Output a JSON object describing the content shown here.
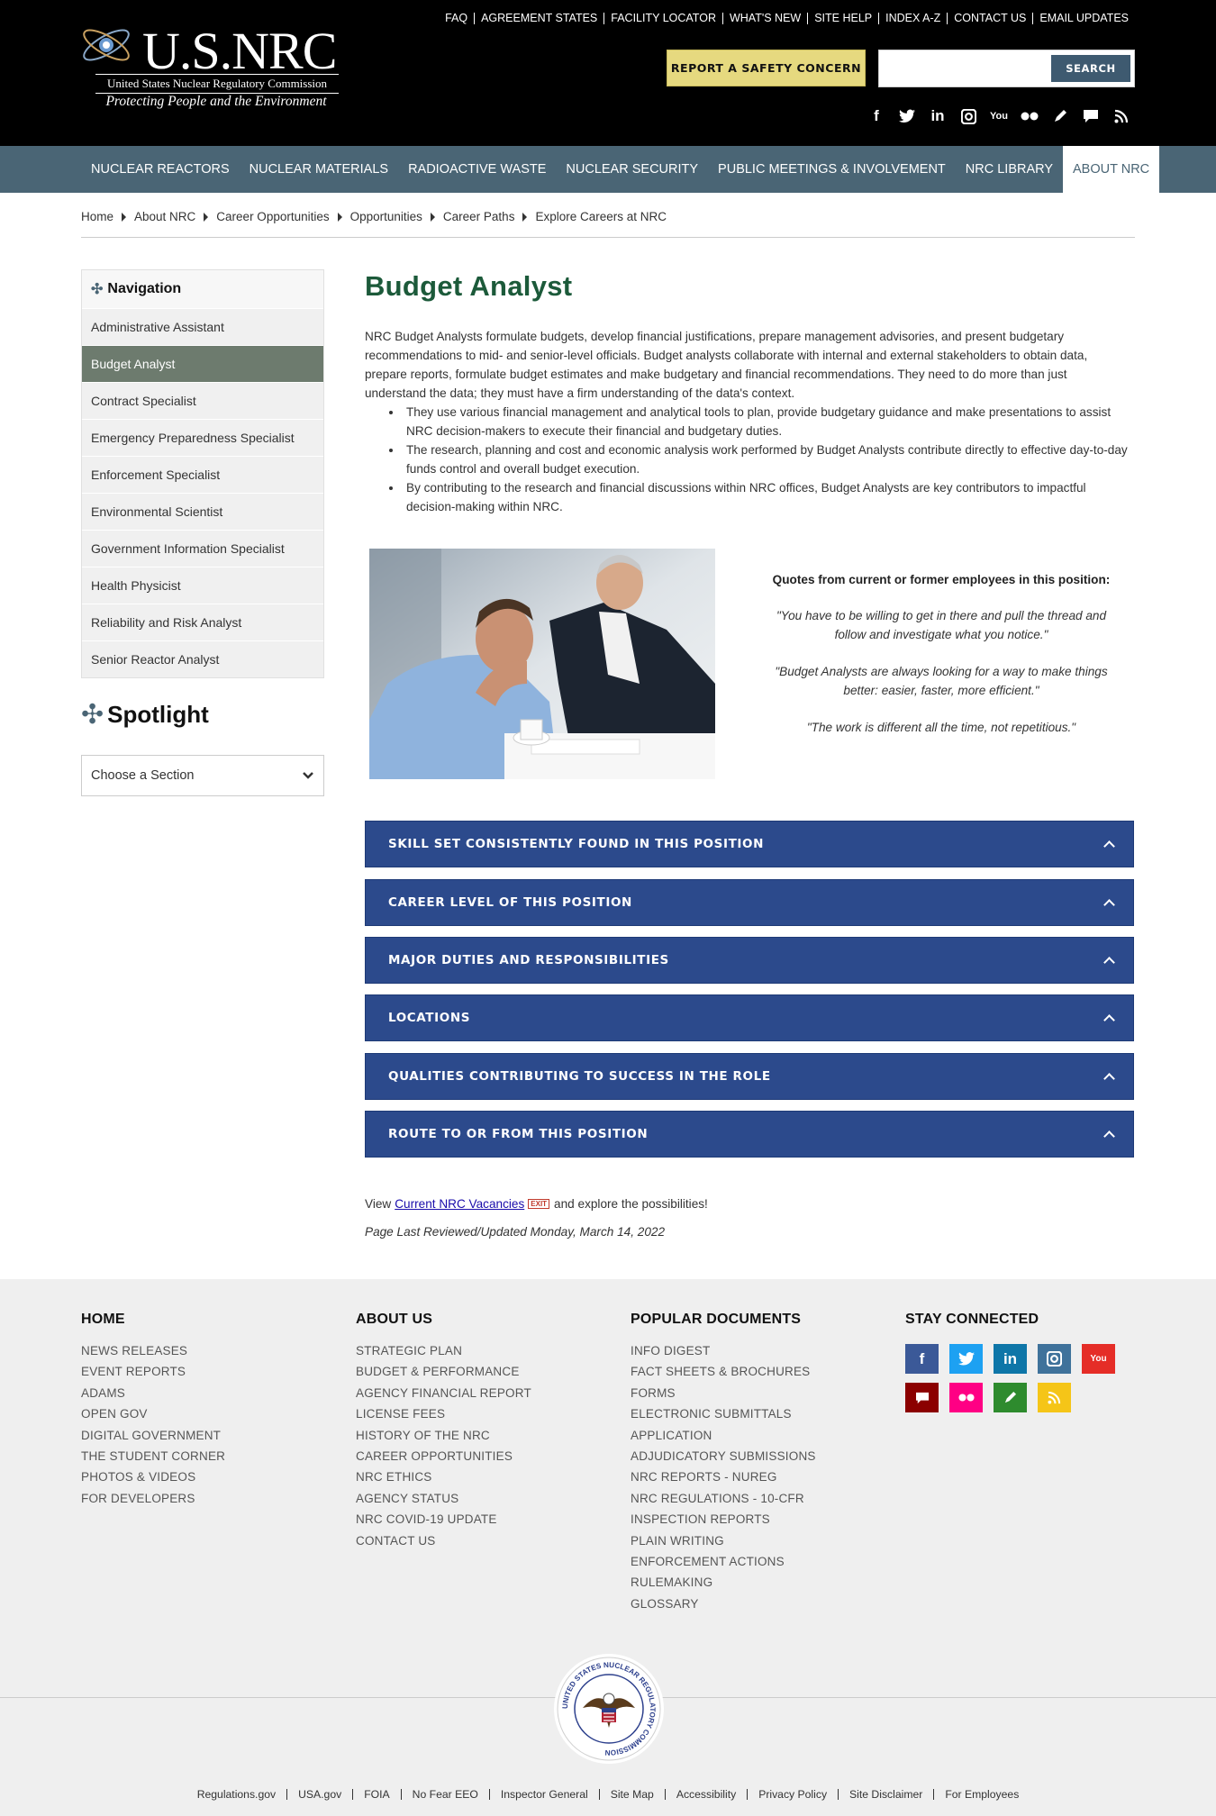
{
  "header": {
    "logo_name": "U.S.NRC",
    "logo_subtitle": "United States Nuclear Regulatory Commission",
    "logo_tagline": "Protecting People and the Environment",
    "utility_links": [
      "FAQ",
      "AGREEMENT STATES",
      "FACILITY LOCATOR",
      "WHAT'S NEW",
      "SITE HELP",
      "INDEX A-Z",
      "CONTACT US",
      "EMAIL UPDATES"
    ],
    "report_button": "REPORT A SAFETY CONCERN",
    "search_placeholder": "",
    "search_button": "SEARCH",
    "social_icons": [
      "facebook-icon",
      "twitter-icon",
      "linkedin-icon",
      "instagram-icon",
      "youtube-icon",
      "flickr-icon",
      "blog-icon",
      "chat-icon",
      "rss-icon"
    ]
  },
  "nav": {
    "items": [
      "NUCLEAR REACTORS",
      "NUCLEAR MATERIALS",
      "RADIOACTIVE WASTE",
      "NUCLEAR SECURITY",
      "PUBLIC MEETINGS & INVOLVEMENT",
      "NRC LIBRARY",
      "ABOUT NRC"
    ],
    "active": "ABOUT NRC"
  },
  "breadcrumb": [
    "Home",
    "About NRC",
    "Career Opportunities",
    "Opportunities",
    "Career Paths",
    "Explore Careers at NRC"
  ],
  "sidebar": {
    "heading": "Navigation",
    "items": [
      "Administrative Assistant",
      "Budget Analyst",
      "Contract Specialist",
      "Emergency Preparedness Specialist",
      "Enforcement Specialist",
      "Environmental Scientist",
      "Government Information Specialist",
      "Health Physicist",
      "Reliability and Risk Analyst",
      "Senior Reactor Analyst"
    ],
    "active_item": "Budget Analyst",
    "spotlight_title": "Spotlight",
    "section_select": "Choose a Section"
  },
  "main": {
    "title": "Budget Analyst",
    "intro": "NRC Budget Analysts formulate budgets, develop financial justifications, prepare management advisories, and present budgetary recommendations to mid- and senior-level officials. Budget analysts collaborate with internal and external stakeholders to obtain data, prepare reports, formulate budget estimates and make budgetary and financial recommendations. They need to do more than just understand the data; they must have a firm understanding of the data's context.",
    "bullets": [
      "They use various financial management and analytical tools to plan, provide budgetary guidance and make presentations to assist NRC decision-makers to execute their financial and budgetary duties.",
      "The research, planning and cost and economic analysis work performed by Budget Analysts contribute directly to effective day-to-day funds control and overall budget execution.",
      "By contributing to the research and financial discussions within NRC offices, Budget Analysts are key contributors to impactful decision-making within NRC."
    ],
    "quotes_heading": "Quotes from current or former employees in this position:",
    "quotes": [
      "\"You have to be willing to get in there and pull the thread and follow and investigate what you notice.\"",
      "\"Budget Analysts are always looking for a way to make things better: easier, faster, more efficient.\"",
      "\"The work is different all the time, not repetitious.\""
    ],
    "accordions": [
      "SKILL SET CONSISTENTLY FOUND IN THIS POSITION",
      "CAREER LEVEL OF THIS POSITION",
      "MAJOR DUTIES AND RESPONSIBILITIES",
      "LOCATIONS",
      "QUALITIES CONTRIBUTING TO SUCCESS IN THE ROLE",
      "ROUTE TO OR FROM THIS POSITION"
    ],
    "view_prefix": "View",
    "vacancies_link": "Current NRC Vacancies",
    "exit_badge": "EXIT",
    "view_suffix": "and explore the possibilities!",
    "last_updated": "Page Last Reviewed/Updated Monday, March 14, 2022"
  },
  "footer": {
    "home": {
      "heading": "HOME",
      "links": [
        "NEWS RELEASES",
        "EVENT REPORTS",
        "ADAMS",
        "OPEN GOV",
        "DIGITAL GOVERNMENT",
        "THE STUDENT CORNER",
        "PHOTOS & VIDEOS",
        "FOR DEVELOPERS"
      ]
    },
    "about": {
      "heading": "ABOUT US",
      "links": [
        "STRATEGIC PLAN",
        "BUDGET & PERFORMANCE",
        "AGENCY FINANCIAL REPORT",
        "LICENSE FEES",
        "HISTORY OF THE NRC",
        "CAREER OPPORTUNITIES",
        "NRC ETHICS",
        "AGENCY STATUS",
        "NRC COVID-19 UPDATE",
        "CONTACT US"
      ]
    },
    "docs": {
      "heading": "POPULAR DOCUMENTS",
      "links": [
        "INFO DIGEST",
        "FACT SHEETS & BROCHURES",
        "FORMS",
        "ELECTRONIC SUBMITTALS",
        "APPLICATION",
        "ADJUDICATORY SUBMISSIONS",
        "NRC REPORTS - NUREG",
        "NRC REGULATIONS - 10-CFR",
        "INSPECTION REPORTS",
        "PLAIN WRITING",
        "ENFORCEMENT ACTIONS",
        "RULEMAKING",
        "GLOSSARY"
      ]
    },
    "stay_connected": "STAY CONNECTED",
    "seal_text": "UNITED STATES NUCLEAR REGULATORY COMMISSION",
    "bottom_links": [
      "Regulations.gov",
      "USA.gov",
      "FOIA",
      "No Fear EEO",
      "Inspector General",
      "Site Map",
      "Accessibility",
      "Privacy Policy",
      "Site Disclaimer",
      "For Employees"
    ]
  },
  "colors": {
    "header_bg": "#000000",
    "nav_bg": "#4a6575",
    "accordion_bg": "#2c4a8c",
    "title_green": "#1c5a3a",
    "report_button": "#e6d97f",
    "footer_bg": "#efefef",
    "social_facebook": "#3b5998",
    "social_twitter": "#1da1f2",
    "social_linkedin": "#0e76a8",
    "social_instagram": "#3f729b",
    "social_youtube": "#e52d27",
    "social_chat": "#8b0000",
    "social_flickr": "#ff0084",
    "social_blog": "#2e8b2e",
    "social_rss": "#f5c518"
  }
}
